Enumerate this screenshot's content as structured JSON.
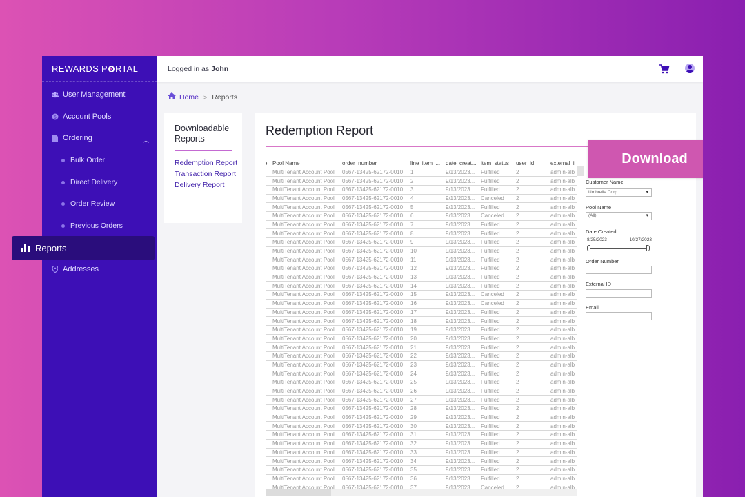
{
  "app": {
    "logo_prefix": "REWARDS P",
    "logo_suffix": "RTAL"
  },
  "topbar": {
    "logged_in_prefix": "Logged in as",
    "user_name": "John",
    "cart_icon": "cart-icon",
    "user_icon": "user-avatar-icon"
  },
  "sidebar": {
    "items": [
      {
        "label": "User Management",
        "icon": "users-icon"
      },
      {
        "label": "Account Pools",
        "icon": "coin-icon"
      },
      {
        "label": "Ordering",
        "icon": "document-icon",
        "expanded": true
      },
      {
        "label": "Reports",
        "icon": "bar-chart-icon",
        "active": true
      },
      {
        "label": "Addresses",
        "icon": "map-pin-icon"
      }
    ],
    "ordering_sub": [
      "Bulk Order",
      "Direct Delivery",
      "Order Review",
      "Previous Orders"
    ]
  },
  "breadcrumb": {
    "home": "Home",
    "separator": ">",
    "current": "Reports"
  },
  "downloadable": {
    "title": "Downloadable Reports",
    "links": [
      "Redemption Report",
      "Transaction Report",
      "Delivery Report"
    ]
  },
  "report": {
    "title": "Redemption Report",
    "columns": [
      "e",
      "Pool Name",
      "order_number",
      "line_item_...",
      "date_creat...",
      "item_status",
      "user_id",
      "external_i"
    ],
    "pool_name": "MultiTenant Account Pool",
    "order_number": "0567-13425-62172-0010",
    "date": "9/13/2023...",
    "user_id": "2",
    "external": "admin-alb",
    "statuses": [
      "Fulfilled",
      "Fulfilled",
      "Fulfilled",
      "Canceled",
      "Fulfilled",
      "Canceled",
      "Fulfilled",
      "Fulfilled",
      "Fulfilled",
      "Fulfilled",
      "Fulfilled",
      "Fulfilled",
      "Fulfilled",
      "Fulfilled",
      "Canceled",
      "Canceled",
      "Fulfilled",
      "Fulfilled",
      "Fulfilled",
      "Fulfilled",
      "Fulfilled",
      "Fulfilled",
      "Fulfilled",
      "Fulfilled",
      "Fulfilled",
      "Fulfilled",
      "Fulfilled",
      "Fulfilled",
      "Fulfilled",
      "Fulfilled",
      "Fulfilled",
      "Fulfilled",
      "Fulfilled",
      "Fulfilled",
      "Fulfilled",
      "Fulfilled",
      "Canceled"
    ]
  },
  "filters": {
    "customer_name_label": "Customer Name",
    "customer_name_value": "Umbrella Corp",
    "pool_name_label": "Pool Name",
    "pool_name_value": "(All)",
    "date_created_label": "Date Created",
    "date_start": "8/25/2023",
    "date_end": "10/27/2023",
    "order_number_label": "Order Number",
    "order_number_value": "",
    "external_id_label": "External ID",
    "external_id_value": "",
    "email_label": "Email",
    "email_value": ""
  },
  "download_button": "Download",
  "colors": {
    "sidebar": "#3d0fb6",
    "sidebar_active": "#2a0d7c",
    "accent_pink": "#cf57b0",
    "link_purple": "#3d1ca8"
  }
}
